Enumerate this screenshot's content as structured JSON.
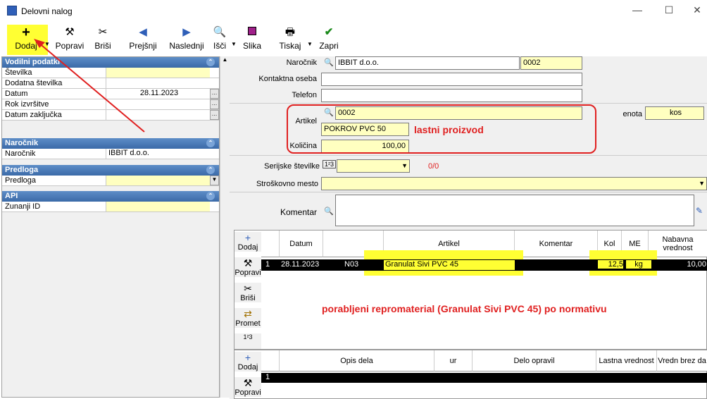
{
  "window": {
    "title": "Delovni nalog",
    "min": "—",
    "max": "☐",
    "close": "✕"
  },
  "toolbar": {
    "dodaj": "Dodaj",
    "popravi": "Popravi",
    "brisi": "Briši",
    "prejsnji": "Prejšnji",
    "naslednji": "Naslednji",
    "isci": "Išči",
    "slika": "Slika",
    "tiskaj": "Tiskaj",
    "zapri": "Zapri"
  },
  "left": {
    "sec_vodilni": "Vodilni podatki",
    "stevilka": "Številka",
    "dodatna": "Dodatna številka",
    "datum": "Datum",
    "datum_val": "28.11.2023",
    "rok": "Rok izvršitve",
    "zakljucka": "Datum zaključka",
    "sec_narocnik": "Naročnik",
    "narocnik": "Naročnik",
    "narocnik_val": "IBBIT d.o.o.",
    "sec_predloga": "Predloga",
    "predloga": "Predloga",
    "sec_api": "API",
    "zunanji": "Zunanji ID"
  },
  "form": {
    "narocnik_lbl": "Naročnik",
    "narocnik_val": "IBBIT d.o.o.",
    "narocnik_code": "0002",
    "kontakt_lbl": "Kontaktna oseba",
    "telefon_lbl": "Telefon",
    "artikel_lbl": "Artikel",
    "artikel_code": "0002",
    "artikel_name": "POKROV PVC 50",
    "lastni": "lastni proizvod",
    "enota_lbl": "enota",
    "enota_val": "kos",
    "kolicina_lbl": "Količina",
    "kolicina_val": "100,00",
    "serijske_lbl": "Serijske številke",
    "serijske_count": "0/0",
    "stroskovno_lbl": "Stroškovno mesto",
    "komentar_lbl": "Komentar"
  },
  "grid1": {
    "side": {
      "dodaj": "Dodaj",
      "popravi": "Popravi",
      "brisi": "Briši",
      "promet": "Promet"
    },
    "headers": {
      "datum": "Datum",
      "artikel": "Artikel",
      "komentar": "Komentar",
      "kol": "Kol",
      "me": "ME",
      "nabavna": "Nabavna vrednost"
    },
    "row": {
      "n": "1",
      "datum": "28.11.2023",
      "code": "N03",
      "artikel": "Granulat Sivi PVC 45",
      "kol": "12,5",
      "me": "kg",
      "vred": "10,00"
    },
    "note": "porabljeni repromaterial (Granulat Sivi PVC 45) po normativu"
  },
  "grid2": {
    "side": {
      "dodaj": "Dodaj",
      "popravi": "Popravi"
    },
    "headers": {
      "opis": "Opis dela",
      "ur": "ur",
      "delo": "Delo opravil",
      "lastna": "Lastna vrednost",
      "vredn": "Vredn brez da"
    },
    "row_n": "1"
  }
}
